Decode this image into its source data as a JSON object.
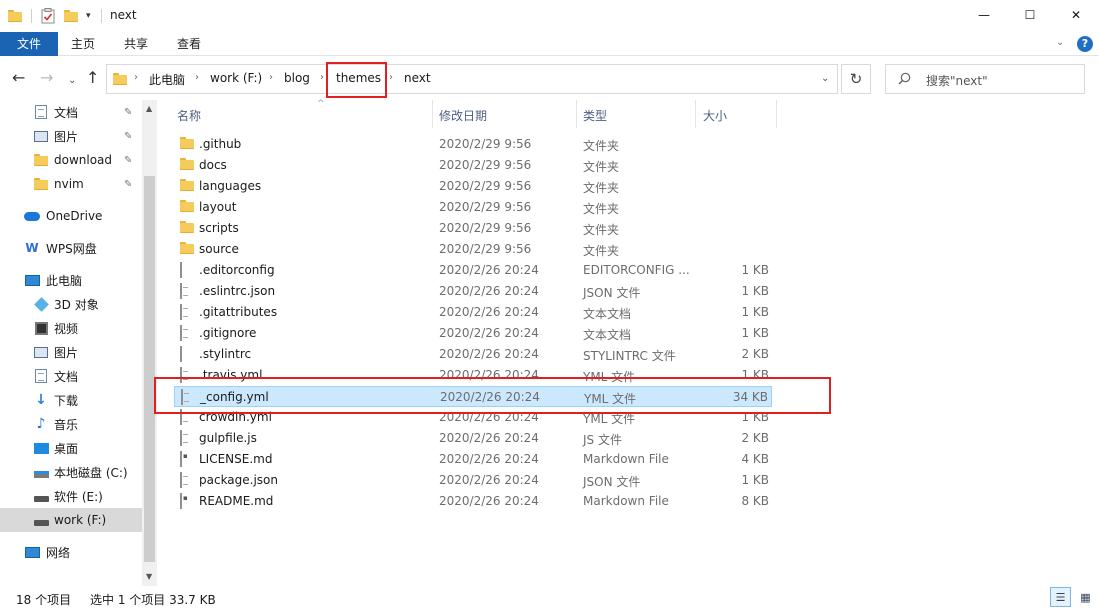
{
  "window": {
    "title": "next",
    "minimize_glyph": "—",
    "maximize_glyph": "☐",
    "close_glyph": "✕"
  },
  "quick_access_toolbar": {
    "dropdown_glyph": "▾"
  },
  "ribbon": {
    "tabs": [
      {
        "label": "文件",
        "active": true
      },
      {
        "label": "主页"
      },
      {
        "label": "共享"
      },
      {
        "label": "查看"
      }
    ],
    "collapse_glyph": "⌄",
    "help_glyph": "?"
  },
  "navigation": {
    "back_glyph": "←",
    "forward_glyph": "→",
    "recent_glyph": "⌄",
    "up_glyph": "↑",
    "refresh_glyph": "↻",
    "dropdown_glyph": "⌄",
    "separator": "›",
    "breadcrumbs": [
      "此电脑",
      "work (F:)",
      "blog",
      "themes",
      "next"
    ],
    "highlighted_crumb": "themes"
  },
  "search": {
    "placeholder": "搜索\"next\"",
    "icon": "search-icon"
  },
  "sidebar": {
    "quick_access": [
      {
        "label": "文档",
        "icon": "document-icon",
        "pinned": true
      },
      {
        "label": "图片",
        "icon": "picture-icon",
        "pinned": true
      },
      {
        "label": "download",
        "icon": "folder-icon",
        "pinned": true
      },
      {
        "label": "nvim",
        "icon": "folder-icon",
        "pinned": true
      }
    ],
    "onedrive": {
      "label": "OneDrive",
      "icon": "cloud-icon"
    },
    "wps": {
      "label": "WPS网盘",
      "icon": "wps-icon"
    },
    "this_pc": {
      "label": "此电脑",
      "icon": "computer-icon",
      "children": [
        {
          "label": "3D 对象",
          "icon": "3d-objects-icon"
        },
        {
          "label": "视频",
          "icon": "video-icon"
        },
        {
          "label": "图片",
          "icon": "picture-icon"
        },
        {
          "label": "文档",
          "icon": "document-icon"
        },
        {
          "label": "下载",
          "icon": "download-icon"
        },
        {
          "label": "音乐",
          "icon": "music-icon"
        },
        {
          "label": "桌面",
          "icon": "desktop-icon"
        },
        {
          "label": "本地磁盘 (C:)",
          "icon": "drive-c-icon"
        },
        {
          "label": "软件 (E:)",
          "icon": "drive-icon"
        },
        {
          "label": "work (F:)",
          "icon": "drive-icon",
          "selected": true
        }
      ]
    },
    "network": {
      "label": "网络",
      "icon": "network-icon"
    },
    "pin_glyph": "📌"
  },
  "file_list": {
    "columns": {
      "name": "名称",
      "date": "修改日期",
      "type": "类型",
      "size": "大小"
    },
    "sort_glyph": "^",
    "rows": [
      {
        "name": ".github",
        "date": "2020/2/29 9:56",
        "type": "文件夹",
        "size": "",
        "icon": "folder-icon"
      },
      {
        "name": "docs",
        "date": "2020/2/29 9:56",
        "type": "文件夹",
        "size": "",
        "icon": "folder-icon"
      },
      {
        "name": "languages",
        "date": "2020/2/29 9:56",
        "type": "文件夹",
        "size": "",
        "icon": "folder-icon"
      },
      {
        "name": "layout",
        "date": "2020/2/29 9:56",
        "type": "文件夹",
        "size": "",
        "icon": "folder-icon"
      },
      {
        "name": "scripts",
        "date": "2020/2/29 9:56",
        "type": "文件夹",
        "size": "",
        "icon": "folder-icon"
      },
      {
        "name": "source",
        "date": "2020/2/29 9:56",
        "type": "文件夹",
        "size": "",
        "icon": "folder-icon"
      },
      {
        "name": ".editorconfig",
        "date": "2020/2/26 20:24",
        "type": "EDITORCONFIG ...",
        "size": "1 KB",
        "icon": "file-icon"
      },
      {
        "name": ".eslintrc.json",
        "date": "2020/2/26 20:24",
        "type": "JSON 文件",
        "size": "1 KB",
        "icon": "text-file-icon"
      },
      {
        "name": ".gitattributes",
        "date": "2020/2/26 20:24",
        "type": "文本文档",
        "size": "1 KB",
        "icon": "text-file-icon"
      },
      {
        "name": ".gitignore",
        "date": "2020/2/26 20:24",
        "type": "文本文档",
        "size": "1 KB",
        "icon": "text-file-icon"
      },
      {
        "name": ".stylintrc",
        "date": "2020/2/26 20:24",
        "type": "STYLINTRC 文件",
        "size": "2 KB",
        "icon": "file-icon"
      },
      {
        "name": ".travis.yml",
        "date": "2020/2/26 20:24",
        "type": "YML 文件",
        "size": "1 KB",
        "icon": "text-file-icon"
      },
      {
        "name": "_config.yml",
        "date": "2020/2/26 20:24",
        "type": "YML 文件",
        "size": "34 KB",
        "icon": "text-file-icon",
        "selected": true
      },
      {
        "name": "crowdin.yml",
        "date": "2020/2/26 20:24",
        "type": "YML 文件",
        "size": "1 KB",
        "icon": "text-file-icon"
      },
      {
        "name": "gulpfile.js",
        "date": "2020/2/26 20:24",
        "type": "JS 文件",
        "size": "2 KB",
        "icon": "text-file-icon"
      },
      {
        "name": "LICENSE.md",
        "date": "2020/2/26 20:24",
        "type": "Markdown File",
        "size": "4 KB",
        "icon": "markdown-icon"
      },
      {
        "name": "package.json",
        "date": "2020/2/26 20:24",
        "type": "JSON 文件",
        "size": "1 KB",
        "icon": "text-file-icon"
      },
      {
        "name": "README.md",
        "date": "2020/2/26 20:24",
        "type": "Markdown File",
        "size": "8 KB",
        "icon": "markdown-icon"
      }
    ]
  },
  "status_bar": {
    "item_count": "18 个项目",
    "selection": "选中 1 个项目  33.7 KB",
    "details_view_glyph": "☰",
    "tiles_view_glyph": "▦"
  },
  "colors": {
    "accent": "#1a64b3",
    "selection_bg": "#cce8ff",
    "highlight_box": "#e02020"
  }
}
